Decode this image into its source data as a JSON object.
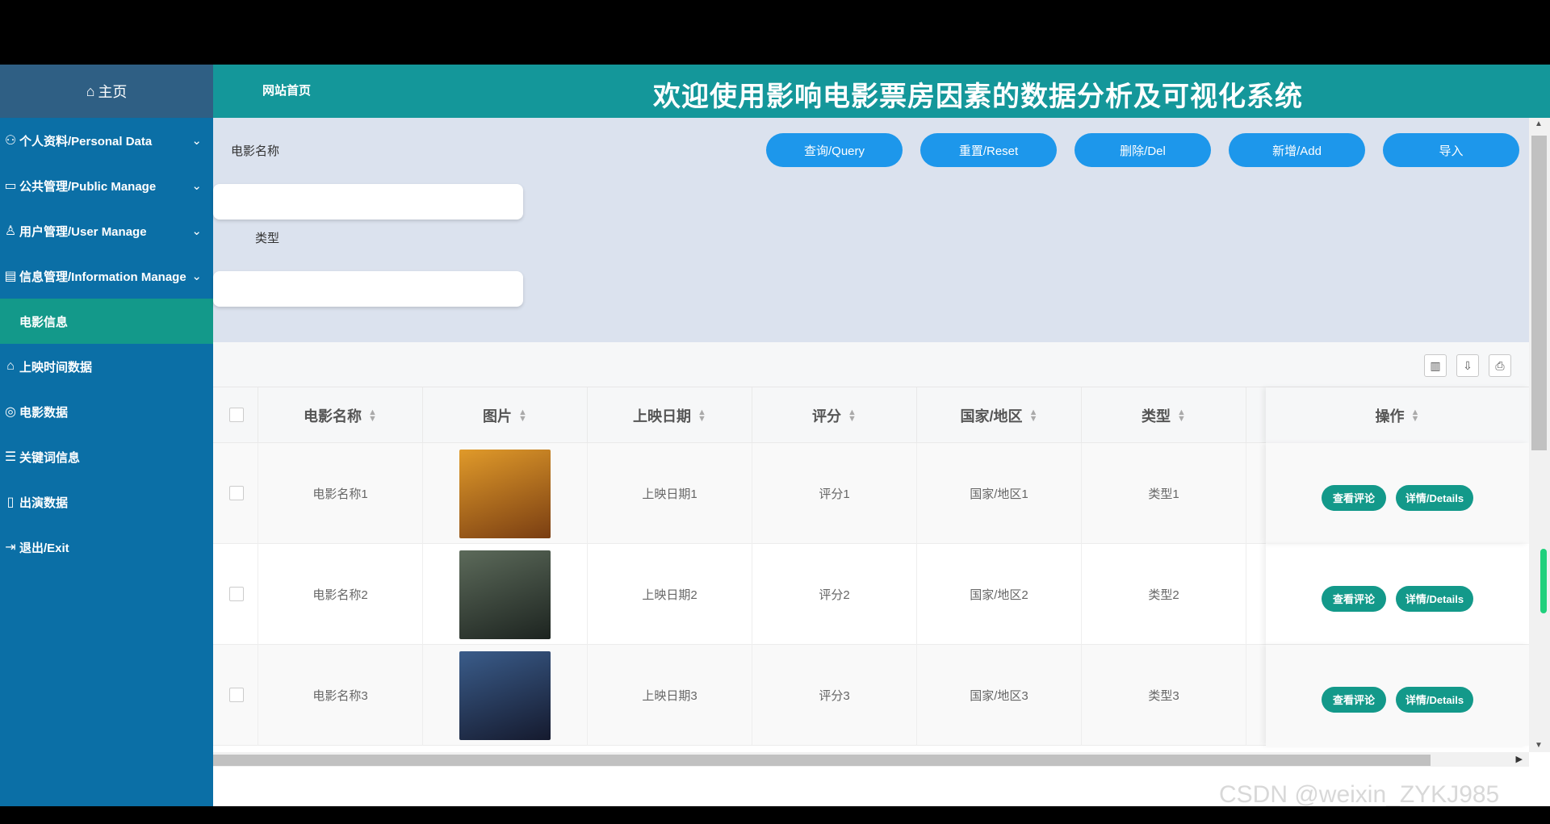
{
  "sidebar": {
    "home": "主页",
    "items": [
      {
        "label": "个人资料/Personal Data",
        "icon": "person-icon",
        "chevron": true
      },
      {
        "label": "公共管理/Public Manage",
        "icon": "monitor-icon",
        "chevron": true
      },
      {
        "label": "用户管理/User Manage",
        "icon": "user-icon",
        "chevron": true
      },
      {
        "label": "信息管理/Information Manage",
        "icon": "document-gear-icon",
        "chevron": true
      },
      {
        "label": "电影信息",
        "icon": "",
        "chevron": false,
        "active": true
      },
      {
        "label": "上映时间数据",
        "icon": "tag-icon",
        "chevron": false
      },
      {
        "label": "电影数据",
        "icon": "target-icon",
        "chevron": false
      },
      {
        "label": "关键词信息",
        "icon": "list-icon",
        "chevron": false
      },
      {
        "label": "出演数据",
        "icon": "phone-icon",
        "chevron": false
      },
      {
        "label": "退出/Exit",
        "icon": "exit-icon",
        "chevron": false
      }
    ]
  },
  "header": {
    "site_link": "网站首页",
    "title": "欢迎使用影响电影票房因素的数据分析及可视化系统"
  },
  "search": {
    "name_label": "电影名称",
    "type_label": "类型",
    "name_value": "",
    "type_value": "",
    "buttons": [
      "查询/Query",
      "重置/Reset",
      "删除/Del",
      "新增/Add",
      "导入"
    ]
  },
  "toolbar": {
    "icons": [
      "columns-icon",
      "export-icon",
      "print-icon"
    ]
  },
  "table": {
    "columns": [
      "电影名称",
      "图片",
      "上映日期",
      "评分",
      "国家/地区",
      "类型",
      "操作"
    ],
    "rows": [
      {
        "name": "电影名称1",
        "date": "上映日期1",
        "score": "评分1",
        "region": "国家/地区1",
        "type": "类型1",
        "poster_colors": [
          "#e09a2a",
          "#7a3e12"
        ]
      },
      {
        "name": "电影名称2",
        "date": "上映日期2",
        "score": "评分2",
        "region": "国家/地区2",
        "type": "类型2",
        "poster_colors": [
          "#5c6a5a",
          "#1d2420"
        ]
      },
      {
        "name": "电影名称3",
        "date": "上映日期3",
        "score": "评分3",
        "region": "国家/地区3",
        "type": "类型3",
        "poster_colors": [
          "#3a5c8a",
          "#151a2e"
        ]
      }
    ],
    "actions": [
      "查看评论",
      "详情/Details"
    ]
  },
  "colors": {
    "sidebar": "#0b6fa6",
    "header": "#14979a",
    "accent_green": "#13998a",
    "button_blue": "#1d97eb"
  },
  "watermark": "CSDN @weixin_ZYKJ985"
}
